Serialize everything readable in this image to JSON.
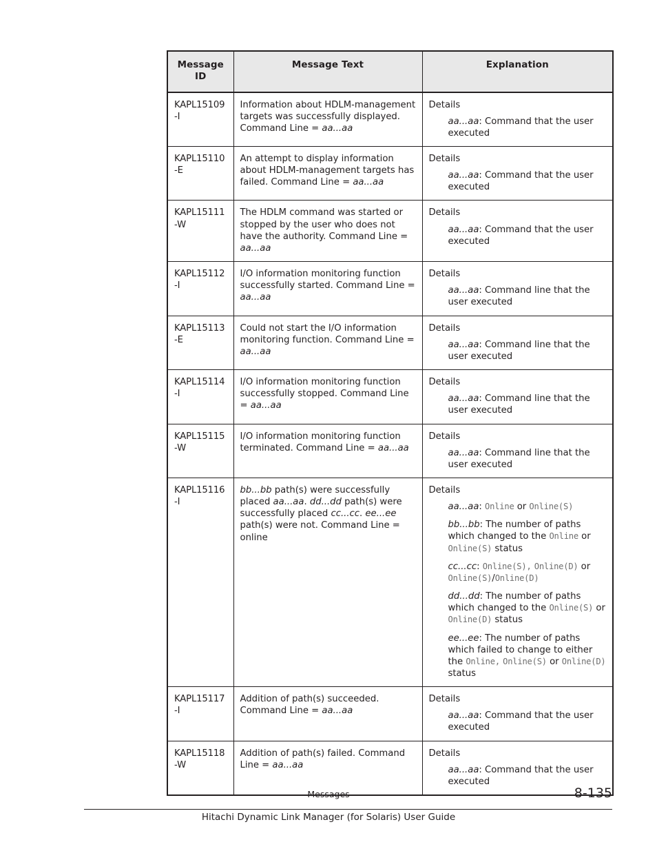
{
  "page": {
    "section": "Messages",
    "page_number": "8-135",
    "guide_title": "Hitachi Dynamic Link Manager (for Solaris) User Guide"
  },
  "table": {
    "columns": [
      "Message ID",
      "Message Text",
      "Explanation"
    ],
    "headers": {
      "id_line1": "Message",
      "id_line2": "ID",
      "text": "Message Text",
      "explanation": "Explanation"
    },
    "rows": [
      {
        "id": "KAPL15109\n-I",
        "text_html": "Information about HDLM-management targets was successfully displayed. Command Line = <i class=\"var\">aa...aa</i>",
        "details_head": "Details",
        "details": [
          "<i class=\"var\">aa...aa</i>: Command that the user executed"
        ]
      },
      {
        "id": "KAPL15110\n-E",
        "text_html": "An attempt to display information about HDLM-management targets has failed. Command Line = <i class=\"var\">aa...aa</i>",
        "details_head": "Details",
        "details": [
          "<i class=\"var\">aa...aa</i>: Command that the user executed"
        ]
      },
      {
        "id": "KAPL15111\n-W",
        "text_html": "The HDLM command was started or stopped by the user who does not have the authority. Command Line = <i class=\"var\">aa...aa</i>",
        "details_head": "Details",
        "details": [
          "<i class=\"var\">aa...aa</i>: Command that the user executed"
        ]
      },
      {
        "id": "KAPL15112\n-I",
        "text_html": "I/O information monitoring function successfully started. Command Line = <i class=\"var\">aa...aa</i>",
        "details_head": "Details",
        "details": [
          "<i class=\"var\">aa...aa</i>: Command line that the user executed"
        ]
      },
      {
        "id": "KAPL15113\n-E",
        "text_html": "Could not start the I/O information monitoring function. Command Line = <i class=\"var\">aa...aa</i>",
        "details_head": "Details",
        "details": [
          "<i class=\"var\">aa...aa</i>: Command line that the user executed"
        ]
      },
      {
        "id": "KAPL15114\n-I",
        "text_html": "I/O information monitoring function successfully stopped. Command Line = <i class=\"var\">aa...aa</i>",
        "details_head": "Details",
        "details": [
          "<i class=\"var\">aa...aa</i>: Command line that the user executed"
        ]
      },
      {
        "id": "KAPL15115\n-W",
        "text_html": "I/O information monitoring function terminated. Command Line = <i class=\"var\">aa...aa</i>",
        "details_head": "Details",
        "details": [
          "<i class=\"var\">aa...aa</i>: Command line that the user executed"
        ]
      },
      {
        "id": "KAPL15116\n-I",
        "text_html": "<i class=\"var\">bb...bb</i> path(s) were successfully placed <i class=\"var\">aa...aa</i>. <i class=\"var\">dd...dd</i> path(s) were successfully placed <i class=\"var\">cc...cc</i>. <i class=\"var\">ee...ee</i> path(s) were not. Command Line = online",
        "details_head": "Details",
        "details": [
          "<i class=\"var\">aa...aa</i>: <span class=\"mono\">Online</span> or <span class=\"mono\">Online(S)</span>",
          "<i class=\"var\">bb...bb</i>: The number of paths which changed to the <span class=\"mono\">Online</span> or <span class=\"mono\">Online(S)</span> status",
          "<i class=\"var\">cc...cc</i>: <span class=\"mono\">Online(S)</span><span class=\"mono\">,</span> <span class=\"mono\">Online(D)</span> or <span class=\"mono\">Online(S)</span>/<span class=\"mono\">Online(D)</span>",
          "<i class=\"var\">dd...dd</i>: The number of paths which changed to the <span class=\"mono\">Online(S)</span> or <span class=\"mono\">Online(D)</span> status",
          "<i class=\"var\">ee...ee</i>: The number of paths which failed to change to either the <span class=\"mono\">Online</span><span class=\"mono\">,</span> <span class=\"mono\">Online(S)</span> or <span class=\"mono\">Online(D)</span> status"
        ]
      },
      {
        "id": "KAPL15117\n-I",
        "text_html": "Addition of path(s) succeeded. Command Line = <i class=\"var\">aa...aa</i>",
        "details_head": "Details",
        "details": [
          "<i class=\"var\">aa...aa</i>: Command that the user executed"
        ]
      },
      {
        "id": "KAPL15118\n-W",
        "text_html": "Addition of path(s) failed. Command Line = <i class=\"var\">aa...aa</i>",
        "details_head": "Details",
        "details": [
          "<i class=\"var\">aa...aa</i>: Command that the user executed"
        ]
      }
    ]
  },
  "colors": {
    "header_bg": "#e8e8e8",
    "ink": "#231f20",
    "mono_text": "#6e6e6e"
  }
}
